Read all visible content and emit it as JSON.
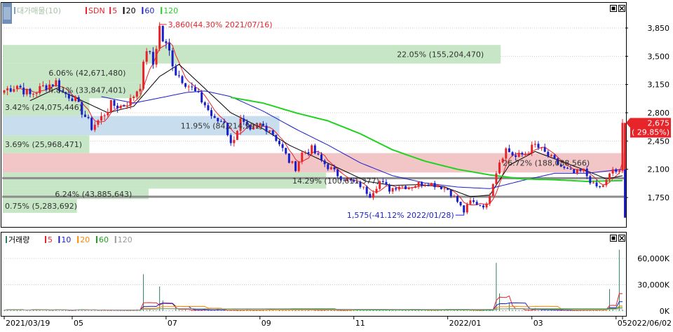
{
  "colors": {
    "frame": "#000000",
    "up_candle": "#e8242b",
    "down_candle": "#1a1fc9",
    "ma5": "#e8242b",
    "ma20": "#000000",
    "ma60": "#1a1fc9",
    "ma120": "#21d321",
    "zone_green": "#c6e6c6",
    "zone_blue": "#c8deee",
    "zone_red": "#f2c6c6",
    "price_tag": "#e8242b",
    "support_line": "#8c8c8c"
  },
  "chart_data": [
    {
      "type": "candlestick",
      "title": "",
      "legend": {
        "first": "대가매물(10)",
        "items": [
          {
            "label": "SDN",
            "color": "#e8242b"
          },
          {
            "label": "5",
            "color": "#e8242b"
          },
          {
            "label": "20",
            "color": "#000000"
          },
          {
            "label": "60",
            "color": "#1a1fc9"
          },
          {
            "label": "120",
            "color": "#21d321"
          }
        ]
      },
      "ylim": [
        1500,
        4000
      ],
      "ytick_labels": [
        "3,850",
        "3,500",
        "3,150",
        "2,800",
        "2,450",
        "2,100",
        "1,750"
      ],
      "ytick_values": [
        3850,
        3500,
        3150,
        2800,
        2450,
        2100,
        1750
      ],
      "grid": true,
      "xtick_labels": [
        "2021/03/19",
        "05",
        "07",
        "09",
        "11",
        "2022/01",
        "03",
        "05",
        "2022/06/02"
      ],
      "price_path": [
        [
          0,
          3080
        ],
        [
          4,
          3140
        ],
        [
          8,
          3020
        ],
        [
          12,
          3120
        ],
        [
          16,
          3180
        ],
        [
          18,
          3050
        ],
        [
          21,
          3000
        ],
        [
          24,
          2820
        ],
        [
          27,
          2620
        ],
        [
          30,
          2740
        ],
        [
          33,
          2900
        ],
        [
          36,
          2880
        ],
        [
          39,
          2950
        ],
        [
          42,
          3150
        ],
        [
          44,
          3600
        ],
        [
          46,
          3400
        ],
        [
          48,
          3860
        ],
        [
          49,
          3700
        ],
        [
          51,
          3550
        ],
        [
          53,
          3300
        ],
        [
          56,
          3180
        ],
        [
          59,
          3050
        ],
        [
          62,
          2900
        ],
        [
          65,
          2700
        ],
        [
          68,
          2700
        ],
        [
          70,
          2400
        ],
        [
          73,
          2700
        ],
        [
          76,
          2550
        ],
        [
          79,
          2650
        ],
        [
          82,
          2600
        ],
        [
          85,
          2420
        ],
        [
          88,
          2200
        ],
        [
          90,
          2120
        ],
        [
          92,
          2300
        ],
        [
          95,
          2350
        ],
        [
          98,
          2200
        ],
        [
          101,
          2100
        ],
        [
          104,
          2000
        ],
        [
          107,
          1950
        ],
        [
          110,
          1900
        ],
        [
          113,
          1780
        ],
        [
          116,
          1950
        ],
        [
          119,
          1850
        ],
        [
          122,
          1900
        ],
        [
          125,
          1880
        ],
        [
          128,
          1920
        ],
        [
          131,
          1930
        ],
        [
          134,
          1900
        ],
        [
          137,
          1850
        ],
        [
          140,
          1700
        ],
        [
          142,
          1575
        ],
        [
          144,
          1700
        ],
        [
          147,
          1660
        ],
        [
          149,
          1650
        ],
        [
          151,
          1950
        ],
        [
          153,
          2200
        ],
        [
          155,
          2350
        ],
        [
          158,
          2250
        ],
        [
          161,
          2300
        ],
        [
          164,
          2400
        ],
        [
          167,
          2300
        ],
        [
          170,
          2200
        ],
        [
          173,
          2100
        ],
        [
          176,
          2050
        ],
        [
          179,
          2080
        ],
        [
          182,
          1900
        ],
        [
          184,
          1870
        ],
        [
          186,
          1950
        ],
        [
          188,
          2100
        ],
        [
          190,
          2050
        ],
        [
          191,
          2675
        ]
      ],
      "ma_lines": [
        {
          "name": "20",
          "path": [
            [
              8,
              2950
            ],
            [
              16,
              3100
            ],
            [
              24,
              2950
            ],
            [
              32,
              2800
            ],
            [
              40,
              2880
            ],
            [
              48,
              3250
            ],
            [
              54,
              3400
            ],
            [
              62,
              3100
            ],
            [
              70,
              2800
            ],
            [
              80,
              2600
            ],
            [
              88,
              2400
            ],
            [
              96,
              2250
            ],
            [
              104,
              2100
            ],
            [
              112,
              1950
            ],
            [
              120,
              1900
            ],
            [
              128,
              1910
            ],
            [
              136,
              1880
            ],
            [
              144,
              1760
            ],
            [
              150,
              1780
            ],
            [
              156,
              2150
            ],
            [
              164,
              2320
            ],
            [
              172,
              2200
            ],
            [
              180,
              2080
            ],
            [
              186,
              1980
            ],
            [
              191,
              2020
            ]
          ]
        },
        {
          "name": "60",
          "path": [
            [
              30,
              3000
            ],
            [
              40,
              2920
            ],
            [
              50,
              3000
            ],
            [
              56,
              3050
            ],
            [
              62,
              3070
            ],
            [
              70,
              3000
            ],
            [
              80,
              2820
            ],
            [
              90,
              2600
            ],
            [
              100,
              2400
            ],
            [
              110,
              2180
            ],
            [
              120,
              2020
            ],
            [
              130,
              1930
            ],
            [
              140,
              1880
            ],
            [
              150,
              1860
            ],
            [
              160,
              1960
            ],
            [
              170,
              2050
            ],
            [
              180,
              2050
            ],
            [
              191,
              2100
            ]
          ]
        },
        {
          "name": "120",
          "path": [
            [
              70,
              2990
            ],
            [
              80,
              2920
            ],
            [
              90,
              2800
            ],
            [
              100,
              2700
            ],
            [
              110,
              2540
            ],
            [
              120,
              2340
            ],
            [
              130,
              2200
            ],
            [
              140,
              2100
            ],
            [
              150,
              2030
            ],
            [
              160,
              1980
            ],
            [
              170,
              1970
            ],
            [
              180,
              1950
            ],
            [
              191,
              1960
            ]
          ]
        }
      ],
      "supply_zones": [
        {
          "label": "22.05% (155,204,470)",
          "price_from": 3410,
          "price_to": 3640,
          "x_end_frac": 0.8,
          "label_pos": "right",
          "zone": "green"
        },
        {
          "label": "6.06% (42,671,480)",
          "price_from": 3180,
          "price_to": 3410,
          "x_end_frac": 0.225,
          "label_pos": "right",
          "zone": "green"
        },
        {
          "label": "4.81% (33,847,401)",
          "price_from": 2980,
          "price_to": 3180,
          "x_end_frac": 0.225,
          "label_pos": "right",
          "zone": "green"
        },
        {
          "label": "3.42% (24,075,446)",
          "price_from": 2760,
          "price_to": 2980,
          "x_end_frac": 0.14,
          "label_pos": "left",
          "zone": "green"
        },
        {
          "label": "11.95% (84,214,991)",
          "price_from": 2520,
          "price_to": 2760,
          "x_end_frac": 0.445,
          "label_pos": "right",
          "zone": "blue"
        },
        {
          "label": "3.69% (25,968,471)",
          "price_from": 2300,
          "price_to": 2520,
          "x_end_frac": 0.14,
          "label_pos": "left",
          "zone": "green"
        },
        {
          "label": "26.72% (188,088,566)",
          "price_from": 2060,
          "price_to": 2300,
          "x_end_frac": 1.0,
          "label_pos": "right",
          "zone": "red"
        },
        {
          "label": "14.29% (100,611,377)",
          "price_from": 1860,
          "price_to": 2060,
          "x_end_frac": 0.52,
          "label_pos": "right",
          "zone": "green"
        },
        {
          "label": "6.24% (43,885,643)",
          "price_from": 1730,
          "price_to": 1860,
          "x_end_frac": 0.235,
          "label_pos": "right",
          "zone": "green"
        },
        {
          "label": "0.75% (5,283,692)",
          "price_from": 1560,
          "price_to": 1730,
          "x_end_frac": 0.12,
          "label_pos": "left",
          "zone": "green"
        }
      ],
      "support_lines": [
        1990,
        1760
      ],
      "annotations": [
        {
          "text": "3,860(44.30% 2021/07/16)",
          "price": 3860,
          "index": 48
        },
        {
          "text": "1,575(-41.12% 2022/01/28)",
          "price": 1575,
          "index": 142
        }
      ],
      "last_price": {
        "price": "2,675",
        "change": "( 29.85%)",
        "value": 2675
      }
    },
    {
      "type": "bar",
      "title": "",
      "legend": {
        "first": "거래량",
        "items": [
          {
            "label": "5",
            "color": "#e8242b"
          },
          {
            "label": "10",
            "color": "#1a1fc9"
          },
          {
            "label": "20",
            "color": "#ff8800"
          },
          {
            "label": "60",
            "color": "#21a021"
          },
          {
            "label": "120",
            "color": "#9a9a9a"
          }
        ]
      },
      "ylim": [
        0,
        80000
      ],
      "ytick_labels": [
        "60,000K",
        "30,000K",
        "0K"
      ],
      "ytick_values": [
        60000,
        30000,
        0
      ],
      "volume_spikes": [
        {
          "index": 3,
          "value": 800
        },
        {
          "index": 26,
          "value": 500
        },
        {
          "index": 43,
          "value": 42000
        },
        {
          "index": 48,
          "value": 28000
        },
        {
          "index": 49,
          "value": 12000
        },
        {
          "index": 53,
          "value": 6000
        },
        {
          "index": 88,
          "value": 1500
        },
        {
          "index": 101,
          "value": 1200
        },
        {
          "index": 142,
          "value": 1500
        },
        {
          "index": 152,
          "value": 55000
        },
        {
          "index": 153,
          "value": 20000
        },
        {
          "index": 156,
          "value": 9000
        },
        {
          "index": 164,
          "value": 3500
        },
        {
          "index": 187,
          "value": 25000
        },
        {
          "index": 190,
          "value": 70000
        }
      ]
    }
  ]
}
